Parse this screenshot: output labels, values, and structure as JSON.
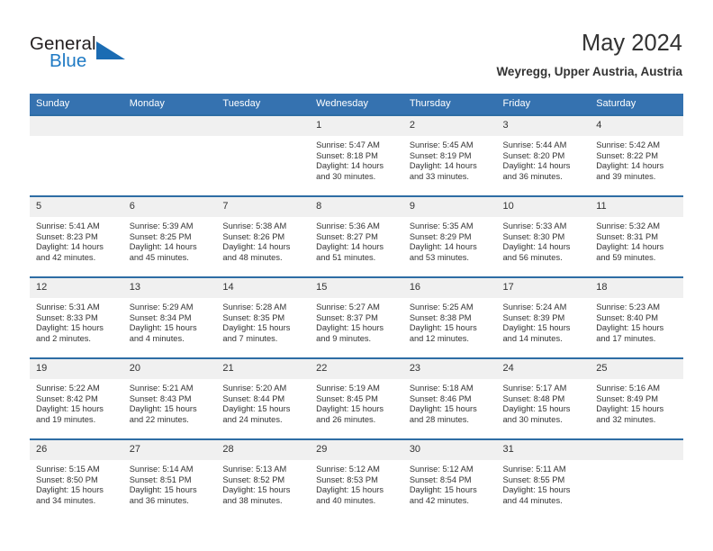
{
  "brand": {
    "name_top": "General",
    "name_bottom": "Blue",
    "accent_color": "#1f7ac4",
    "triangle_color": "#1b6cb3",
    "logo_icon": "triangle-icon"
  },
  "header": {
    "title": "May 2024",
    "subtitle": "Weyregg, Upper Austria, Austria"
  },
  "calendar": {
    "header_bg": "#3572b0",
    "row_border_color": "#2e6da4",
    "day_band_bg": "#f0f0f0",
    "weekday_headers": [
      "Sunday",
      "Monday",
      "Tuesday",
      "Wednesday",
      "Thursday",
      "Friday",
      "Saturday"
    ],
    "labels": {
      "sunrise": "Sunrise:",
      "sunset": "Sunset:",
      "daylight": "Daylight:"
    },
    "weeks": [
      [
        {
          "day": "",
          "empty": true
        },
        {
          "day": "",
          "empty": true
        },
        {
          "day": "",
          "empty": true
        },
        {
          "day": "1",
          "sunrise": "Sunrise: 5:47 AM",
          "sunset": "Sunset: 8:18 PM",
          "daylight": "Daylight: 14 hours and 30 minutes."
        },
        {
          "day": "2",
          "sunrise": "Sunrise: 5:45 AM",
          "sunset": "Sunset: 8:19 PM",
          "daylight": "Daylight: 14 hours and 33 minutes."
        },
        {
          "day": "3",
          "sunrise": "Sunrise: 5:44 AM",
          "sunset": "Sunset: 8:20 PM",
          "daylight": "Daylight: 14 hours and 36 minutes."
        },
        {
          "day": "4",
          "sunrise": "Sunrise: 5:42 AM",
          "sunset": "Sunset: 8:22 PM",
          "daylight": "Daylight: 14 hours and 39 minutes."
        }
      ],
      [
        {
          "day": "5",
          "sunrise": "Sunrise: 5:41 AM",
          "sunset": "Sunset: 8:23 PM",
          "daylight": "Daylight: 14 hours and 42 minutes."
        },
        {
          "day": "6",
          "sunrise": "Sunrise: 5:39 AM",
          "sunset": "Sunset: 8:25 PM",
          "daylight": "Daylight: 14 hours and 45 minutes."
        },
        {
          "day": "7",
          "sunrise": "Sunrise: 5:38 AM",
          "sunset": "Sunset: 8:26 PM",
          "daylight": "Daylight: 14 hours and 48 minutes."
        },
        {
          "day": "8",
          "sunrise": "Sunrise: 5:36 AM",
          "sunset": "Sunset: 8:27 PM",
          "daylight": "Daylight: 14 hours and 51 minutes."
        },
        {
          "day": "9",
          "sunrise": "Sunrise: 5:35 AM",
          "sunset": "Sunset: 8:29 PM",
          "daylight": "Daylight: 14 hours and 53 minutes."
        },
        {
          "day": "10",
          "sunrise": "Sunrise: 5:33 AM",
          "sunset": "Sunset: 8:30 PM",
          "daylight": "Daylight: 14 hours and 56 minutes."
        },
        {
          "day": "11",
          "sunrise": "Sunrise: 5:32 AM",
          "sunset": "Sunset: 8:31 PM",
          "daylight": "Daylight: 14 hours and 59 minutes."
        }
      ],
      [
        {
          "day": "12",
          "sunrise": "Sunrise: 5:31 AM",
          "sunset": "Sunset: 8:33 PM",
          "daylight": "Daylight: 15 hours and 2 minutes."
        },
        {
          "day": "13",
          "sunrise": "Sunrise: 5:29 AM",
          "sunset": "Sunset: 8:34 PM",
          "daylight": "Daylight: 15 hours and 4 minutes."
        },
        {
          "day": "14",
          "sunrise": "Sunrise: 5:28 AM",
          "sunset": "Sunset: 8:35 PM",
          "daylight": "Daylight: 15 hours and 7 minutes."
        },
        {
          "day": "15",
          "sunrise": "Sunrise: 5:27 AM",
          "sunset": "Sunset: 8:37 PM",
          "daylight": "Daylight: 15 hours and 9 minutes."
        },
        {
          "day": "16",
          "sunrise": "Sunrise: 5:25 AM",
          "sunset": "Sunset: 8:38 PM",
          "daylight": "Daylight: 15 hours and 12 minutes."
        },
        {
          "day": "17",
          "sunrise": "Sunrise: 5:24 AM",
          "sunset": "Sunset: 8:39 PM",
          "daylight": "Daylight: 15 hours and 14 minutes."
        },
        {
          "day": "18",
          "sunrise": "Sunrise: 5:23 AM",
          "sunset": "Sunset: 8:40 PM",
          "daylight": "Daylight: 15 hours and 17 minutes."
        }
      ],
      [
        {
          "day": "19",
          "sunrise": "Sunrise: 5:22 AM",
          "sunset": "Sunset: 8:42 PM",
          "daylight": "Daylight: 15 hours and 19 minutes."
        },
        {
          "day": "20",
          "sunrise": "Sunrise: 5:21 AM",
          "sunset": "Sunset: 8:43 PM",
          "daylight": "Daylight: 15 hours and 22 minutes."
        },
        {
          "day": "21",
          "sunrise": "Sunrise: 5:20 AM",
          "sunset": "Sunset: 8:44 PM",
          "daylight": "Daylight: 15 hours and 24 minutes."
        },
        {
          "day": "22",
          "sunrise": "Sunrise: 5:19 AM",
          "sunset": "Sunset: 8:45 PM",
          "daylight": "Daylight: 15 hours and 26 minutes."
        },
        {
          "day": "23",
          "sunrise": "Sunrise: 5:18 AM",
          "sunset": "Sunset: 8:46 PM",
          "daylight": "Daylight: 15 hours and 28 minutes."
        },
        {
          "day": "24",
          "sunrise": "Sunrise: 5:17 AM",
          "sunset": "Sunset: 8:48 PM",
          "daylight": "Daylight: 15 hours and 30 minutes."
        },
        {
          "day": "25",
          "sunrise": "Sunrise: 5:16 AM",
          "sunset": "Sunset: 8:49 PM",
          "daylight": "Daylight: 15 hours and 32 minutes."
        }
      ],
      [
        {
          "day": "26",
          "sunrise": "Sunrise: 5:15 AM",
          "sunset": "Sunset: 8:50 PM",
          "daylight": "Daylight: 15 hours and 34 minutes."
        },
        {
          "day": "27",
          "sunrise": "Sunrise: 5:14 AM",
          "sunset": "Sunset: 8:51 PM",
          "daylight": "Daylight: 15 hours and 36 minutes."
        },
        {
          "day": "28",
          "sunrise": "Sunrise: 5:13 AM",
          "sunset": "Sunset: 8:52 PM",
          "daylight": "Daylight: 15 hours and 38 minutes."
        },
        {
          "day": "29",
          "sunrise": "Sunrise: 5:12 AM",
          "sunset": "Sunset: 8:53 PM",
          "daylight": "Daylight: 15 hours and 40 minutes."
        },
        {
          "day": "30",
          "sunrise": "Sunrise: 5:12 AM",
          "sunset": "Sunset: 8:54 PM",
          "daylight": "Daylight: 15 hours and 42 minutes."
        },
        {
          "day": "31",
          "sunrise": "Sunrise: 5:11 AM",
          "sunset": "Sunset: 8:55 PM",
          "daylight": "Daylight: 15 hours and 44 minutes."
        },
        {
          "day": "",
          "empty": true
        }
      ]
    ]
  }
}
